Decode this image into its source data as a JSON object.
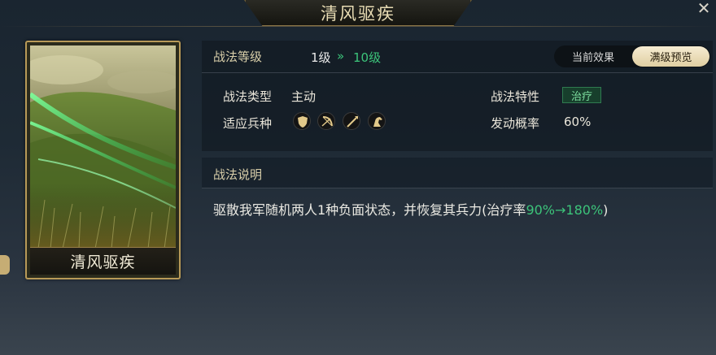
{
  "window": {
    "title": "清风驱疾",
    "close_glyph": "✕"
  },
  "card": {
    "name": "清风驱疾"
  },
  "header": {
    "level_label": "战法等级",
    "level_current": "1级",
    "level_arrow": "»",
    "level_max": "10级",
    "toggle": {
      "current_label": "当前效果",
      "max_label": "满级预览",
      "selected": "满级预览"
    }
  },
  "attributes": {
    "type_label": "战法类型",
    "type_value": "主动",
    "trait_label": "战法特性",
    "trait_value": "治疗",
    "troops_label": "适应兵种",
    "troops": [
      "shield-icon",
      "bow-icon",
      "spear-icon",
      "horse-icon"
    ],
    "chance_label": "发动概率",
    "chance_value": "60%"
  },
  "description": {
    "title": "战法说明",
    "text_prefix": "驱散我军随机两人1种负面状态，并恢复其兵力(治疗率",
    "heal_from": "90%",
    "heal_arrow": "→",
    "heal_to": "180%",
    "text_suffix": ")"
  },
  "colors": {
    "accent_green": "#3cc47a",
    "gold": "#d9cfaa",
    "card_border": "#b89a58"
  }
}
